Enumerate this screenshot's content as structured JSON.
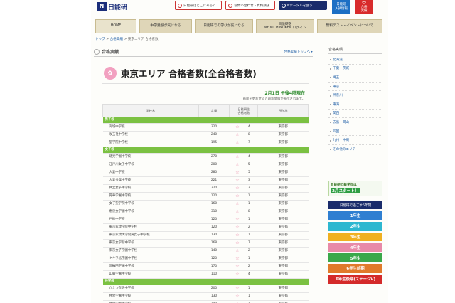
{
  "header": {
    "logo_mark": "N",
    "logo_text": "日能研",
    "buttons": [
      {
        "label": "日能研はどこにある？"
      },
      {
        "label": "お問い合わせ・資料請求"
      },
      {
        "label": "Nポータルを使う"
      }
    ],
    "square_buttons": [
      {
        "label_1": "日能研",
        "label_2": "入試情報"
      },
      {
        "label_1": "合格",
        "label_2": "実績"
      }
    ]
  },
  "nav": [
    {
      "label": "HOME"
    },
    {
      "label": "中学受験が気になる"
    },
    {
      "label": "日能研での学びが気になる"
    },
    {
      "label": "日能研を\nMY NICHINOKEN ログイン"
    },
    {
      "label": "無料テスト・イベントについて"
    }
  ],
  "breadcrumb": {
    "items": [
      "トップ",
      "合格実績",
      "東京エリア 合格者数"
    ],
    "sep": " > "
  },
  "section": {
    "title": "合格実績",
    "more_link": "合格実績トップへ ▸"
  },
  "main_title": "東京エリア 合格者数(全合格者数)",
  "updated": "2月1日 午後4時現在",
  "note": "画面を更新すると最新情報が表示されます。",
  "table": {
    "headers": [
      "学校名",
      "定員",
      "日能研生\n合格者数",
      "",
      "所在地"
    ],
    "groups": [
      {
        "label": "男子校",
        "rows": [
          {
            "name": "海城中学校",
            "cap": "320",
            "count": "4",
            "loc": "東京都"
          },
          {
            "name": "攻玉社中学校",
            "cap": "240",
            "count": "8",
            "loc": "東京都"
          },
          {
            "name": "聖学院中学校",
            "cap": "195",
            "count": "7",
            "loc": "東京都"
          }
        ]
      },
      {
        "label": "女子校",
        "rows": [
          {
            "name": "跡見学園中学校",
            "cap": "270",
            "count": "4",
            "loc": "東京都"
          },
          {
            "name": "江戸川女子中学校",
            "cap": "200",
            "count": "5",
            "loc": "東京都"
          },
          {
            "name": "大妻中学校",
            "cap": "280",
            "count": "5",
            "loc": "東京都"
          },
          {
            "name": "大妻多摩中学校",
            "cap": "221",
            "count": "3",
            "loc": "東京都"
          },
          {
            "name": "共立女子中学校",
            "cap": "320",
            "count": "3",
            "loc": "東京都"
          },
          {
            "name": "晃華学園中学校",
            "cap": "120",
            "count": "1",
            "loc": "東京都"
          },
          {
            "name": "女子聖学院中学校",
            "cap": "160",
            "count": "1",
            "loc": "東京都"
          },
          {
            "name": "恵泉女学園中学校",
            "cap": "310",
            "count": "8",
            "loc": "東京都"
          },
          {
            "name": "戸板中学校",
            "cap": "120",
            "count": "1",
            "loc": "東京都"
          },
          {
            "name": "東京家政学院中学校",
            "cap": "120",
            "count": "2",
            "loc": "東京都"
          },
          {
            "name": "東京家政大学附属女子中学校",
            "cap": "130",
            "count": "1",
            "loc": "東京都"
          },
          {
            "name": "東京女学館中学校",
            "cap": "168",
            "count": "7",
            "loc": "東京都"
          },
          {
            "name": "東京女子学園中学校",
            "cap": "140",
            "count": "2",
            "loc": "東京都"
          },
          {
            "name": "トキワ松学園中学校",
            "cap": "120",
            "count": "1",
            "loc": "東京都"
          },
          {
            "name": "三輪田学園中学校",
            "cap": "170",
            "count": "2",
            "loc": "東京都"
          },
          {
            "name": "山脇学園中学校",
            "cap": "110",
            "count": "4",
            "loc": "東京都"
          }
        ]
      },
      {
        "label": "共学校",
        "rows": [
          {
            "name": "かえつ有明中学校",
            "cap": "200",
            "count": "1",
            "loc": "東京都"
          },
          {
            "name": "共栄学園中学校",
            "cap": "130",
            "count": "1",
            "loc": "東京都"
          },
          {
            "name": "啓明学園中学校",
            "cap": "140",
            "count": "1",
            "loc": "東京都"
          }
        ]
      }
    ]
  },
  "sidebar": {
    "title": "合格実績",
    "items": [
      "北海道",
      "千葉・茨城",
      "埼玉",
      "東京",
      "神奈川",
      "東海",
      "関西",
      "広島・岡山",
      "四国",
      "九州・沖縄",
      "その他のエリア"
    ],
    "promo_line1": "日能研の新学年は",
    "promo_line2": "2月スタート！",
    "grade_head": "日能研で過ごす6年間",
    "grades": [
      {
        "label": "1年生",
        "color": "#2f7fd1"
      },
      {
        "label": "2年生",
        "color": "#2db7d0"
      },
      {
        "label": "3年生",
        "color": "#f0b020"
      },
      {
        "label": "4年生",
        "color": "#e88aa8"
      },
      {
        "label": "5年生",
        "color": "#3aa84a"
      },
      {
        "label": "6年生前期",
        "color": "#e07a2a"
      },
      {
        "label": "6年生後期(ステージV)",
        "color": "#d42a2a"
      }
    ]
  }
}
